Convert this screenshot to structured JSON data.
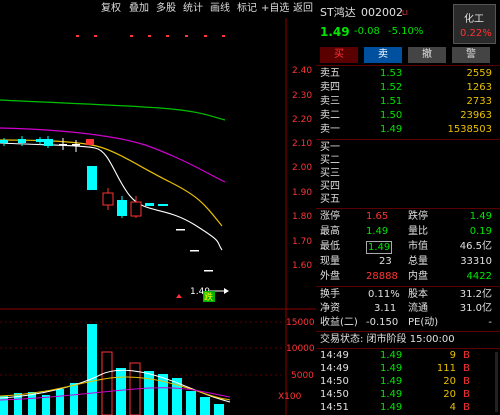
{
  "toolbar": {
    "items": [
      "复权",
      "叠加",
      "多股",
      "统计",
      "画线",
      "标记",
      "+自选",
      "返回"
    ]
  },
  "chart": {
    "price_labels": [
      "2.40",
      "2.30",
      "2.20",
      "2.10",
      "2.00",
      "1.90",
      "1.80",
      "1.70",
      "1.60"
    ],
    "volume_labels": [
      "15000",
      "10000",
      "5000"
    ],
    "volume_unit": "X100",
    "last_price_label": "1.49",
    "limit_badge": "跌",
    "colors": {
      "up": "#ff3333",
      "down": "#00ffff",
      "ma5": "#ffffff",
      "ma10": "#e8c000",
      "ma20": "#d000d0",
      "ma60": "#00c000"
    }
  },
  "quote": {
    "name": "ST鸿达",
    "code": "002002",
    "tag": "LI",
    "industry_label": "化工",
    "industry_pct": "0.22%",
    "price": "1.49",
    "change": "-0.08",
    "change_pct": "-5.10%"
  },
  "actions": {
    "buy": "买",
    "sell": "卖",
    "cancel": "撤",
    "alert": "警"
  },
  "sell_orders": [
    {
      "label": "卖五",
      "price": "1.53",
      "volume": "2559"
    },
    {
      "label": "卖四",
      "price": "1.52",
      "volume": "1263"
    },
    {
      "label": "卖三",
      "price": "1.51",
      "volume": "2733"
    },
    {
      "label": "卖二",
      "price": "1.50",
      "volume": "23963"
    },
    {
      "label": "卖一",
      "price": "1.49",
      "volume": "1538503"
    }
  ],
  "buy_orders": [
    {
      "label": "买一"
    },
    {
      "label": "买二"
    },
    {
      "label": "买三"
    },
    {
      "label": "买四"
    },
    {
      "label": "买五"
    }
  ],
  "stats": {
    "zhangting_label": "涨停",
    "zhangting": "1.65",
    "dieting_label": "跌停",
    "dieting": "1.49",
    "high_label": "最高",
    "high": "1.49",
    "liangbi_label": "量比",
    "liangbi": "0.19",
    "low_label": "最低",
    "low": "1.49",
    "shizhi_label": "市值",
    "shizhi": "46.5亿",
    "xianliang_label": "现量",
    "xianliang": "23",
    "zongliang_label": "总量",
    "zongliang": "33310",
    "waipan_label": "外盘",
    "waipan": "28888",
    "neipan_label": "内盘",
    "neipan": "4422",
    "huanshou_label": "换手",
    "huanshou": "0.11%",
    "guben_label": "股本",
    "guben": "31.2亿",
    "jingzi_label": "净资",
    "jingzi": "3.11",
    "liutong_label": "流通",
    "liutong": "31.0亿",
    "shouyi_label": "收益(二)",
    "shouyi": "-0.150",
    "pe_label": "PE(动)",
    "pe": "-"
  },
  "trade_status": "交易状态: 闭市阶段 15:00:00",
  "ticks": [
    {
      "time": "14:49",
      "price": "1.49",
      "volume": "9",
      "side": "B"
    },
    {
      "time": "14:49",
      "price": "1.49",
      "volume": "111",
      "side": "B"
    },
    {
      "time": "14:50",
      "price": "1.49",
      "volume": "20",
      "side": "B"
    },
    {
      "time": "14:50",
      "price": "1.49",
      "volume": "20",
      "side": "B"
    },
    {
      "time": "14:51",
      "price": "1.49",
      "volume": "4",
      "side": "B"
    }
  ]
}
